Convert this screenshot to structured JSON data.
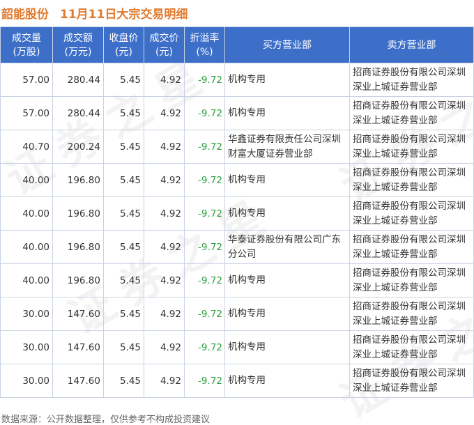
{
  "title": {
    "stock_name": "韶能股份",
    "subtitle": "11月11日大宗交易明细"
  },
  "headers": [
    [
      "成交量",
      "(万股)"
    ],
    [
      "成交额",
      "(万元)"
    ],
    [
      "收盘价",
      "(元)"
    ],
    [
      "成交价",
      "(元)"
    ],
    [
      "折溢率",
      "(%)"
    ],
    [
      "买方营业部"
    ],
    [
      "卖方营业部"
    ]
  ],
  "rows": [
    {
      "volume": "57.00",
      "amount": "280.44",
      "close": "5.45",
      "price": "4.92",
      "rate": "-9.72",
      "buyer": "机构专用",
      "seller": "招商证券股份有限公司深圳深业上城证券营业部"
    },
    {
      "volume": "57.00",
      "amount": "280.44",
      "close": "5.45",
      "price": "4.92",
      "rate": "-9.72",
      "buyer": "机构专用",
      "seller": "招商证券股份有限公司深圳深业上城证券营业部"
    },
    {
      "volume": "40.70",
      "amount": "200.24",
      "close": "5.45",
      "price": "4.92",
      "rate": "-9.72",
      "buyer": "华鑫证券有限责任公司深圳财富大厦证券营业部",
      "seller": "招商证券股份有限公司深圳深业上城证券营业部"
    },
    {
      "volume": "40.00",
      "amount": "196.80",
      "close": "5.45",
      "price": "4.92",
      "rate": "-9.72",
      "buyer": "机构专用",
      "seller": "招商证券股份有限公司深圳深业上城证券营业部"
    },
    {
      "volume": "40.00",
      "amount": "196.80",
      "close": "5.45",
      "price": "4.92",
      "rate": "-9.72",
      "buyer": "机构专用",
      "seller": "招商证券股份有限公司深圳深业上城证券营业部"
    },
    {
      "volume": "40.00",
      "amount": "196.80",
      "close": "5.45",
      "price": "4.92",
      "rate": "-9.72",
      "buyer": "华泰证券股份有限公司广东分公司",
      "seller": "招商证券股份有限公司深圳深业上城证券营业部"
    },
    {
      "volume": "40.00",
      "amount": "196.80",
      "close": "5.45",
      "price": "4.92",
      "rate": "-9.72",
      "buyer": "机构专用",
      "seller": "招商证券股份有限公司深圳深业上城证券营业部"
    },
    {
      "volume": "30.00",
      "amount": "147.60",
      "close": "5.45",
      "price": "4.92",
      "rate": "-9.72",
      "buyer": "机构专用",
      "seller": "招商证券股份有限公司深圳深业上城证券营业部"
    },
    {
      "volume": "30.00",
      "amount": "147.60",
      "close": "5.45",
      "price": "4.92",
      "rate": "-9.72",
      "buyer": "机构专用",
      "seller": "招商证券股份有限公司深圳深业上城证券营业部"
    },
    {
      "volume": "30.00",
      "amount": "147.60",
      "close": "5.45",
      "price": "4.92",
      "rate": "-9.72",
      "buyer": "机构专用",
      "seller": "招商证券股份有限公司深圳深业上城证券营业部"
    }
  ],
  "footer": "数据来源：公开数据整理，仅供参考不构成投资建议",
  "watermark": "证券之星",
  "colors": {
    "header_bg": "#3d6fc9",
    "title": "#e07a2c",
    "negative_rate": "#2e9e3e"
  }
}
